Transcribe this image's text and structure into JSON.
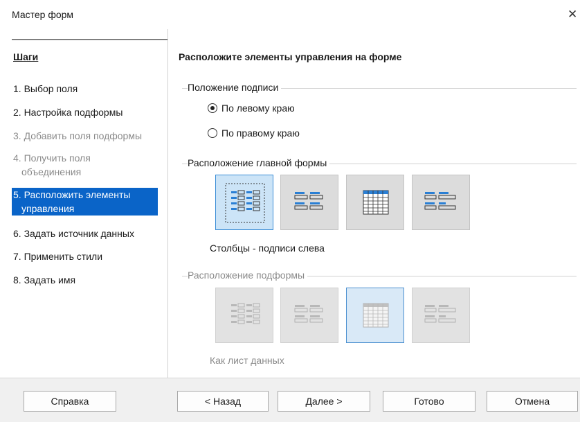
{
  "window": {
    "title": "Мастер форм"
  },
  "sidebar": {
    "title": "Шаги",
    "steps": [
      {
        "label": "1. Выбор поля",
        "state": "normal"
      },
      {
        "label": "2. Настройка подформы",
        "state": "normal"
      },
      {
        "label": "3. Добавить поля подформы",
        "state": "disabled"
      },
      {
        "label": "4. Получить поля",
        "label2": "объединения",
        "state": "disabled"
      },
      {
        "label": "5. Расположить элементы",
        "label2": "управления",
        "state": "active"
      },
      {
        "label": "6. Задать источник данных",
        "state": "normal"
      },
      {
        "label": "7. Применить стили",
        "state": "normal"
      },
      {
        "label": "8. Задать имя",
        "state": "normal"
      }
    ]
  },
  "main": {
    "title": "Расположите элементы управления на форме",
    "label_position": {
      "group": "Положение подписи",
      "option_left": "По левому краю",
      "option_right": "По правому краю",
      "selected": "left"
    },
    "main_layout": {
      "group": "Расположение главной формы",
      "caption": "Столбцы - подписи слева",
      "selected_index": 0,
      "options": [
        "columns-labels-left-icon",
        "columns-labels-top-icon",
        "datasheet-icon",
        "blocks-labels-top-icon"
      ]
    },
    "sub_layout": {
      "group": "Расположение подформы",
      "caption": "Как лист данных",
      "enabled": false,
      "selected_index": 2
    }
  },
  "footer": {
    "help": "Справка",
    "back": "< Назад",
    "next": "Далее >",
    "finish": "Готово",
    "cancel": "Отмена"
  }
}
